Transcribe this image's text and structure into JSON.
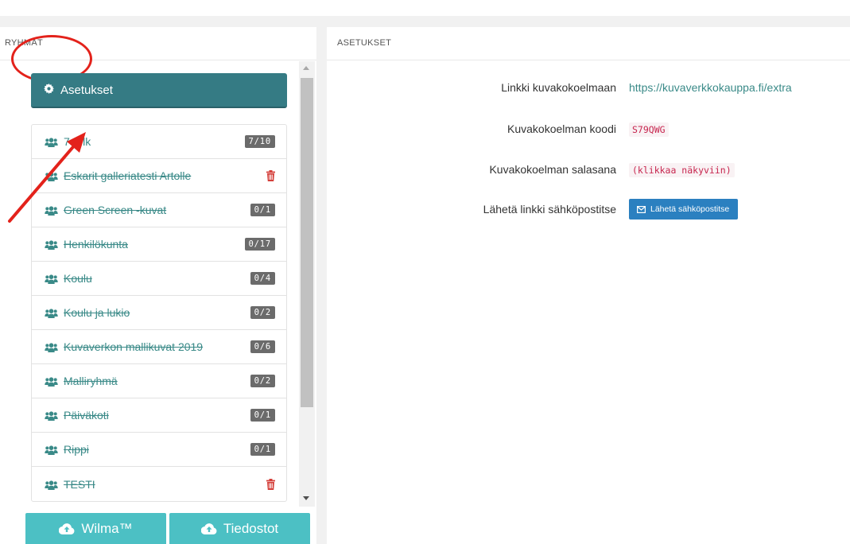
{
  "left": {
    "header": "RYHMÄT",
    "settings_label": "Asetukset",
    "groups": [
      {
        "name": "7-9 lk",
        "badge": "7/10",
        "strike": false
      },
      {
        "name": "Eskarit galleriatesti Artolle",
        "badge": "",
        "strike": true,
        "trash": true
      },
      {
        "name": "Green Screen -kuvat",
        "badge": "0/1",
        "strike": true
      },
      {
        "name": "Henkilökunta",
        "badge": "0/17",
        "strike": true
      },
      {
        "name": "Koulu",
        "badge": "0/4",
        "strike": true
      },
      {
        "name": "Koulu ja lukio",
        "badge": "0/2",
        "strike": true
      },
      {
        "name": "Kuvaverkon mallikuvat 2019",
        "badge": "0/6",
        "strike": true
      },
      {
        "name": "Malliryhmä",
        "badge": "0/2",
        "strike": true
      },
      {
        "name": "Päiväkoti",
        "badge": "0/1",
        "strike": true
      },
      {
        "name": "Rippi",
        "badge": "0/1",
        "strike": true
      },
      {
        "name": "TESTI",
        "badge": "",
        "strike": true,
        "trash": true
      }
    ],
    "wilma_label": "Wilma™",
    "files_label": "Tiedostot"
  },
  "right": {
    "header": "ASETUKSET",
    "link_key": "Linkki kuvakokoelmaan",
    "link_value": "https://kuvaverkkokauppa.fi/extra",
    "code_key": "Kuvakokoelman koodi",
    "code_value": "S79QWG",
    "password_key": "Kuvakokoelman salasana",
    "password_value": "(klikkaa näkyviin)",
    "email_key": "Lähetä linkki sähköpostitse",
    "email_button": "Lähetä sähköpostitse"
  },
  "colors": {
    "teal_dark": "#357b84",
    "teal_light": "#4cc0c4",
    "link": "#3a8a88",
    "annotation_red": "#e3221b",
    "send_blue": "#2b80c0"
  }
}
